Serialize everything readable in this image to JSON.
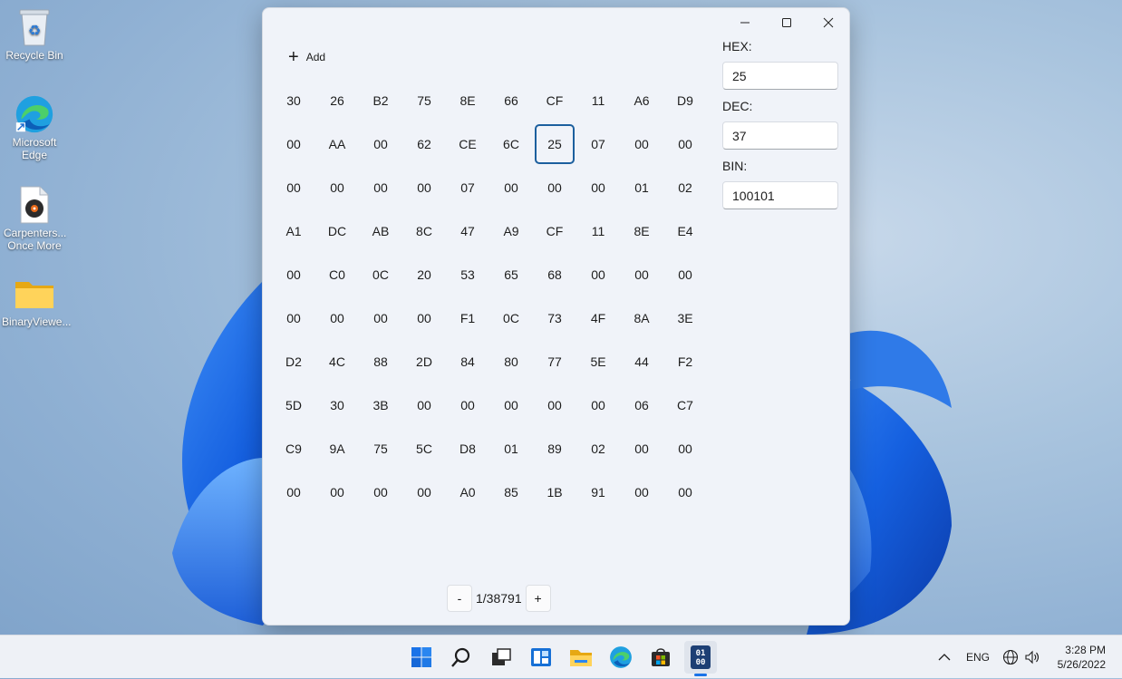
{
  "desktop": {
    "icons": [
      {
        "label": "Recycle Bin"
      },
      {
        "label": "Microsoft Edge"
      },
      {
        "label": "Carpenters... Once More"
      },
      {
        "label": "BinaryViewe..."
      }
    ]
  },
  "window": {
    "add_label": "Add",
    "grid": [
      [
        "30",
        "26",
        "B2",
        "75",
        "8E",
        "66",
        "CF",
        "11",
        "A6",
        "D9"
      ],
      [
        "00",
        "AA",
        "00",
        "62",
        "CE",
        "6C",
        "25",
        "07",
        "00",
        "00"
      ],
      [
        "00",
        "00",
        "00",
        "00",
        "07",
        "00",
        "00",
        "00",
        "01",
        "02"
      ],
      [
        "A1",
        "DC",
        "AB",
        "8C",
        "47",
        "A9",
        "CF",
        "11",
        "8E",
        "E4"
      ],
      [
        "00",
        "C0",
        "0C",
        "20",
        "53",
        "65",
        "68",
        "00",
        "00",
        "00"
      ],
      [
        "00",
        "00",
        "00",
        "00",
        "F1",
        "0C",
        "73",
        "4F",
        "8A",
        "3E"
      ],
      [
        "D2",
        "4C",
        "88",
        "2D",
        "84",
        "80",
        "77",
        "5E",
        "44",
        "F2"
      ],
      [
        "5D",
        "30",
        "3B",
        "00",
        "00",
        "00",
        "00",
        "00",
        "06",
        "C7"
      ],
      [
        "C9",
        "9A",
        "75",
        "5C",
        "D8",
        "01",
        "89",
        "02",
        "00",
        "00"
      ],
      [
        "00",
        "00",
        "00",
        "00",
        "A0",
        "85",
        "1B",
        "91",
        "00",
        "00"
      ]
    ],
    "selected": {
      "row": 1,
      "col": 6
    },
    "hex_label": "HEX:",
    "hex_value": "25",
    "dec_label": "DEC:",
    "dec_value": "37",
    "bin_label": "BIN:",
    "bin_value": "100101",
    "pager": {
      "prev": "-",
      "text": "1/38791",
      "next": "+"
    }
  },
  "taskbar": {
    "lang": "ENG",
    "time": "3:28 PM",
    "date": "5/26/2022"
  },
  "colors": {
    "accent": "#1c5f9e",
    "window_bg": "#f0f3f9",
    "taskbar_bg": "#eef1f6"
  }
}
